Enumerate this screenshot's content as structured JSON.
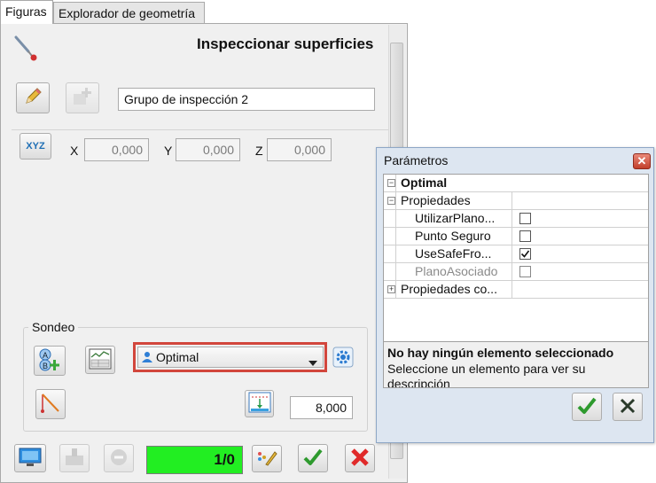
{
  "tabs": [
    {
      "label": "Figuras"
    },
    {
      "label": "Explorador de geometría"
    }
  ],
  "header": {
    "title": "Inspeccionar superficies"
  },
  "group_name": {
    "value": "Grupo de inspección 2"
  },
  "coordinates": {
    "x_label": "X",
    "x_value": "0,000",
    "y_label": "Y",
    "y_value": "0,000",
    "z_label": "Z",
    "z_value": "0,000",
    "xyz_button": "XYZ"
  },
  "probing": {
    "legend": "Sondeo",
    "strategy_selected": "Optimal",
    "distance_value": "8,000"
  },
  "bottom": {
    "counter": "1/0"
  },
  "colors": {
    "counter_bg": "#22ee22",
    "highlight_border": "#d2463c",
    "dialog_bg": "#dde6f1"
  },
  "dialog": {
    "title": "Parámetros",
    "close_label": "✕",
    "group_label": "Optimal",
    "properties_label": "Propiedades",
    "rows": [
      {
        "name": "UtilizarPlano...",
        "checked": false,
        "enabled": true
      },
      {
        "name": "Punto Seguro",
        "checked": false,
        "enabled": true
      },
      {
        "name": "UseSafeFro...",
        "checked": true,
        "enabled": true
      },
      {
        "name": "PlanoAsociado",
        "checked": false,
        "enabled": false
      }
    ],
    "more_properties_label": "Propiedades co...",
    "desc_title": "No hay ningún elemento seleccionado",
    "desc_text": "Seleccione un elemento para ver su descripción"
  }
}
